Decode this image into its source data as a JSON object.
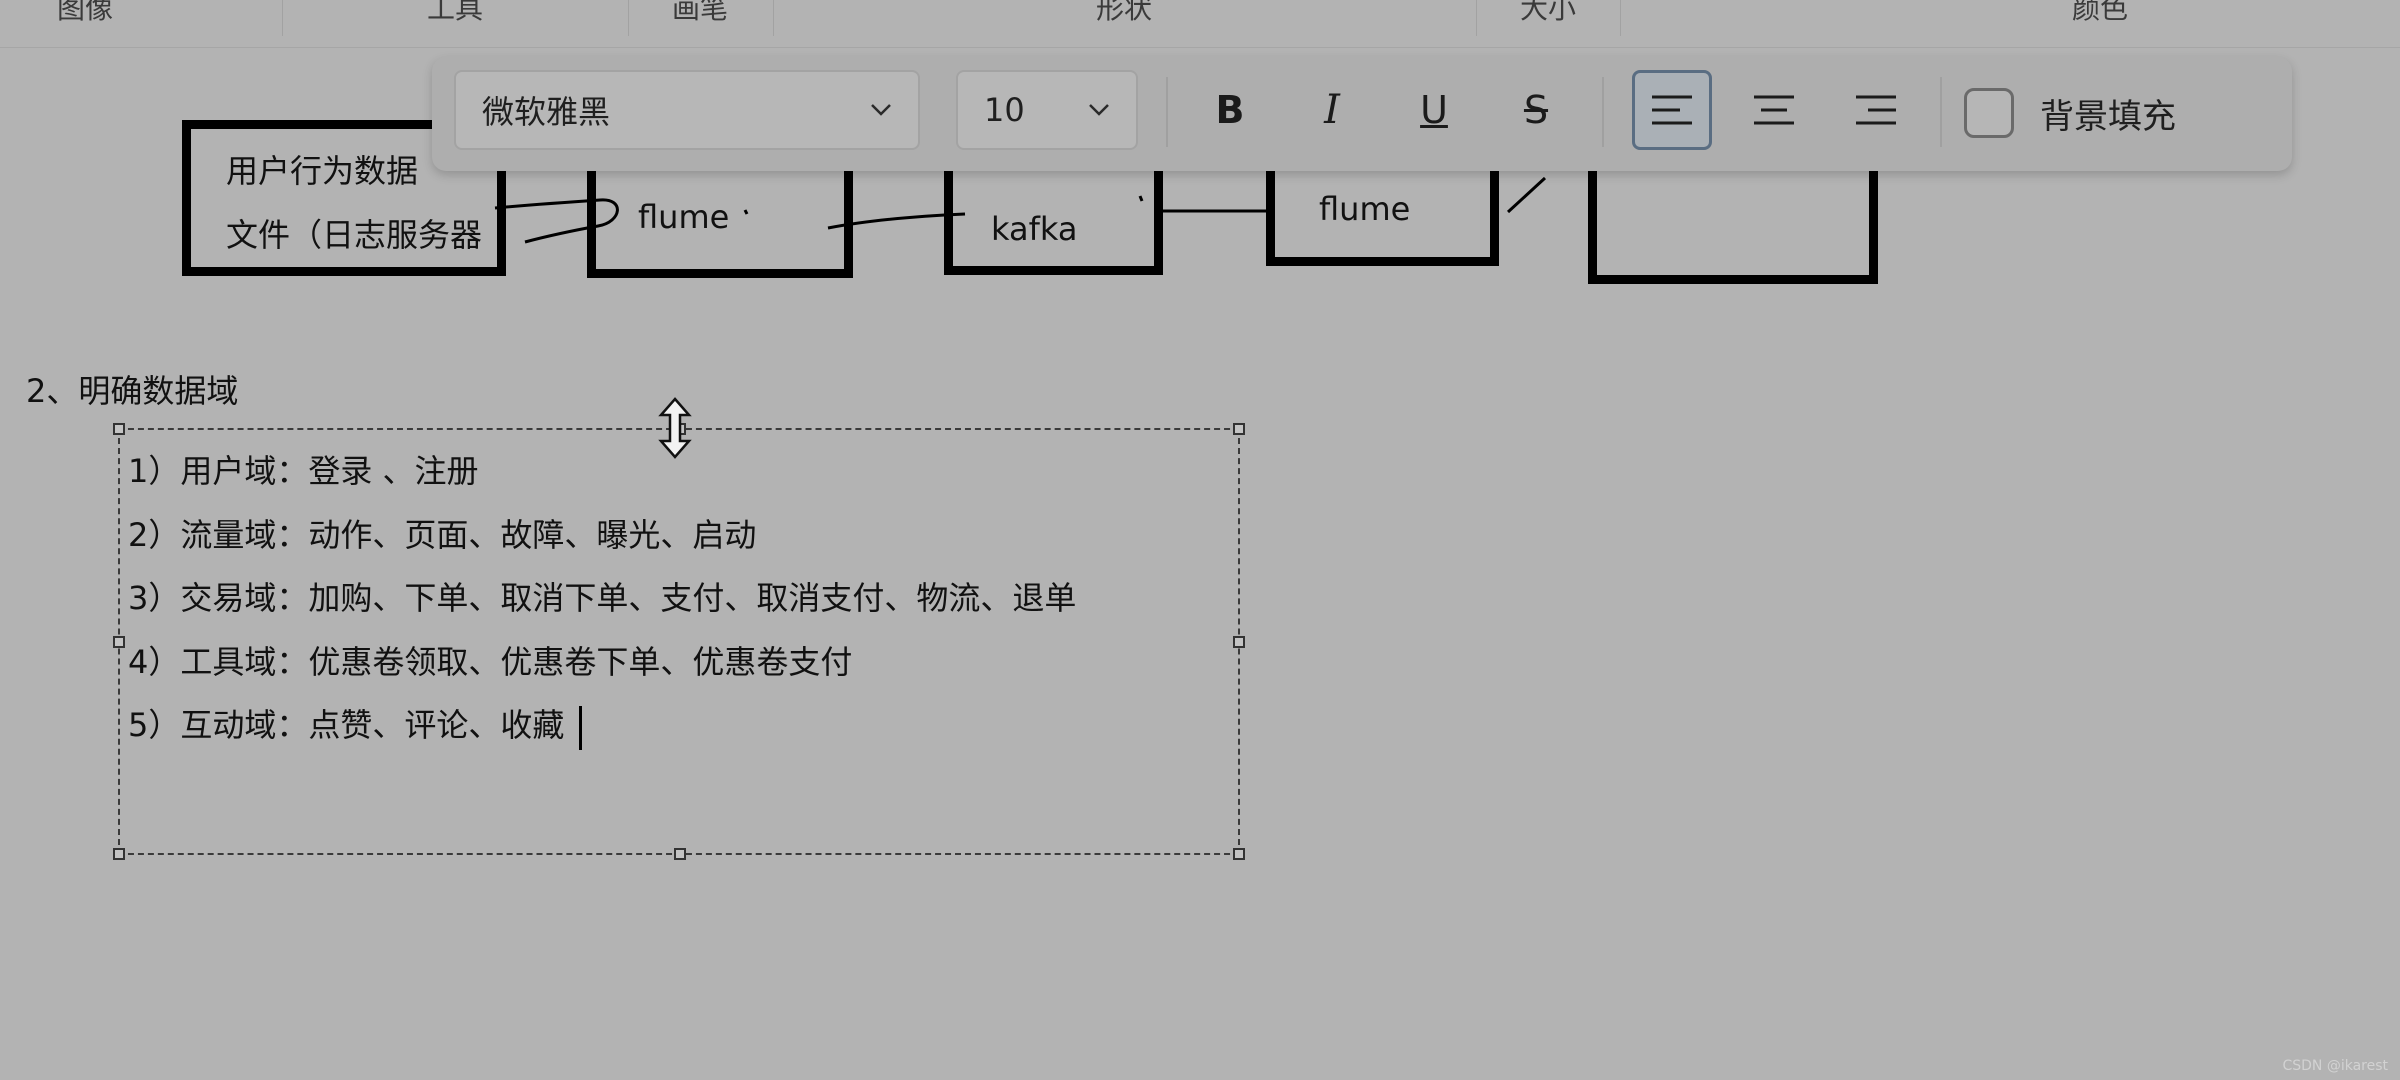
{
  "ribbon": {
    "groups": [
      "图像",
      "工具",
      "画笔",
      "形状",
      "大小",
      "颜色"
    ]
  },
  "text_toolbar": {
    "font_family": "微软雅黑",
    "font_size": "10",
    "bold_label": "B",
    "italic_label": "I",
    "underline_label": "U",
    "strikethrough_label": "S",
    "alignment_selected": "left",
    "background_fill_label": "背景填充",
    "background_fill_checked": false,
    "icons": [
      "chevron-down-icon",
      "align-left-icon",
      "align-center-icon",
      "align-right-icon"
    ]
  },
  "diagram": {
    "source_box": [
      "用户行为数据",
      "文件（日志服务器"
    ],
    "boxes": [
      "flume",
      "kafka",
      "flume",
      ""
    ]
  },
  "section": {
    "heading": "2、明确数据域",
    "items": [
      "1）用户域：登录 、注册",
      "2）流量域：动作、页面、故障、曝光、启动",
      "3）交易域：加购、下单、取消下单、支付、取消支付、物流、退单",
      "4）工具域：优惠卷领取、优惠卷下单、优惠卷支付",
      "5）互动域：点赞、评论、收藏"
    ]
  },
  "watermark": "CSDN @ikarest",
  "colors": {
    "canvas_background": "#b3b3b3",
    "selected_button_border": "#5a6d82"
  }
}
